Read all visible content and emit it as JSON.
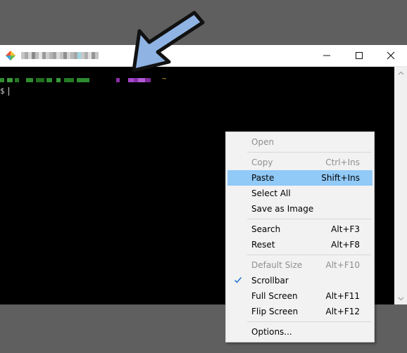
{
  "window": {
    "title": "",
    "controls": {
      "minimize": "minimize",
      "maximize": "maximize",
      "close": "close"
    }
  },
  "terminal": {
    "prompt_suffix": "~",
    "prompt_char": "$"
  },
  "context_menu": {
    "items": [
      {
        "label": "Open",
        "shortcut": "",
        "disabled": true
      },
      {
        "label": "Copy",
        "shortcut": "Ctrl+Ins",
        "disabled": true
      },
      {
        "label": "Paste",
        "shortcut": "Shift+Ins",
        "highlighted": true
      },
      {
        "label": "Select All",
        "shortcut": ""
      },
      {
        "label": "Save as Image",
        "shortcut": ""
      },
      {
        "label": "Search",
        "shortcut": "Alt+F3"
      },
      {
        "label": "Reset",
        "shortcut": "Alt+F8"
      },
      {
        "label": "Default Size",
        "shortcut": "Alt+F10",
        "disabled": true
      },
      {
        "label": "Scrollbar",
        "shortcut": "",
        "checked": true
      },
      {
        "label": "Full Screen",
        "shortcut": "Alt+F11"
      },
      {
        "label": "Flip Screen",
        "shortcut": "Alt+F12"
      },
      {
        "label": "Options...",
        "shortcut": ""
      }
    ]
  },
  "colors": {
    "highlight": "#91c9f7",
    "arrow": "#8fb4e3",
    "check": "#1f6fd1",
    "prompt_user": "#2e8b2e",
    "prompt_path": "#a347c9"
  },
  "icons": {
    "app": "git-diamond-icon",
    "pointer": "arrow-pointer-icon"
  }
}
